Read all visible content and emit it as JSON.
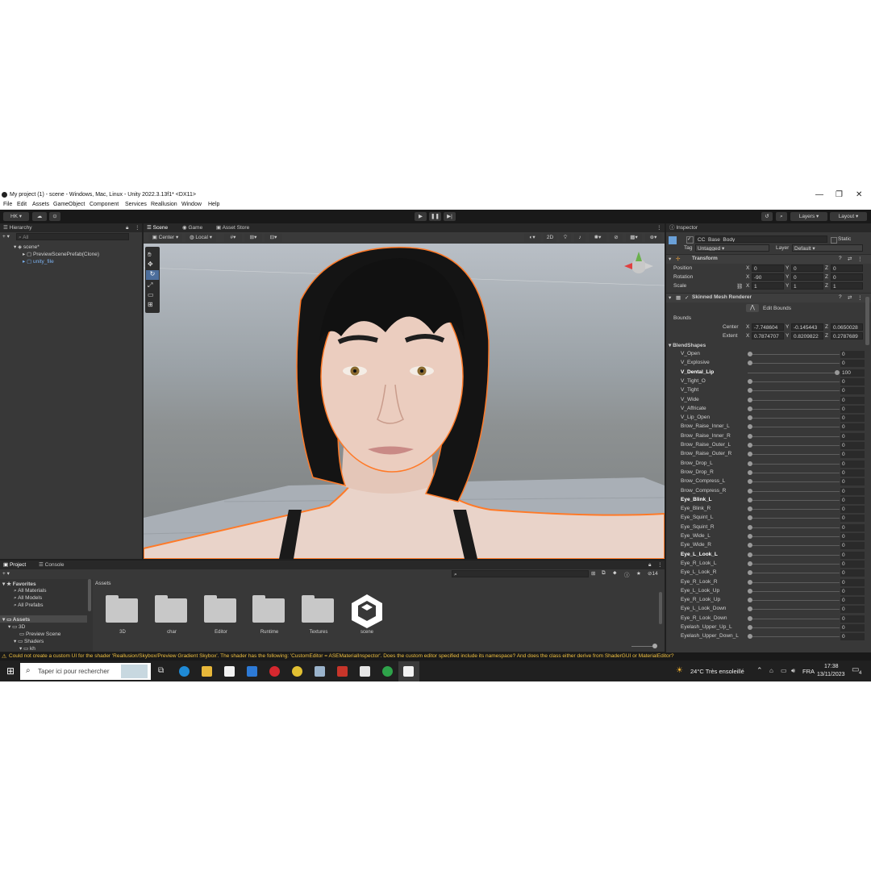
{
  "window": {
    "title": "My project (1) - scene - Windows, Mac, Linux - Unity 2022.3.13f1* <DX11>",
    "controls": [
      "—",
      "❐",
      "✕"
    ]
  },
  "menu": [
    "File",
    "Edit",
    "Assets",
    "GameObject",
    "Component",
    "Services",
    "Reallusion",
    "Window",
    "Help"
  ],
  "toolbar": {
    "account": "HK",
    "layers": "Layers",
    "layout": "Layout"
  },
  "hierarchy": {
    "tab": "Hierarchy",
    "search_placeholder": "All",
    "items": [
      {
        "label": "scene*"
      },
      {
        "label": "PreviewScenePrefab(Clone)"
      },
      {
        "label": "unity_file"
      }
    ]
  },
  "scene_tabs": [
    "Scene",
    "Game",
    "Asset Store"
  ],
  "scene_toolbar": {
    "pivot": "Center",
    "space": "Local",
    "mode_2d": "2D"
  },
  "inspector": {
    "tab": "Inspector",
    "object_name": "CC_Base_Body",
    "static_label": "Static",
    "tag_label": "Tag",
    "tag_value": "Untagged",
    "layer_label": "Layer",
    "layer_value": "Default",
    "transform": {
      "title": "Transform",
      "position_label": "Position",
      "rotation_label": "Rotation",
      "scale_label": "Scale",
      "position": [
        "0",
        "0",
        "0"
      ],
      "rotation": [
        "-90",
        "0",
        "0"
      ],
      "scale": [
        "1",
        "1",
        "1"
      ]
    },
    "smr": {
      "title": "Skinned Mesh Renderer",
      "edit_bounds": "Edit Bounds",
      "bounds_label": "Bounds",
      "center_label": "Center",
      "extent_label": "Extent",
      "center": [
        "-7.748604",
        "-0.145443",
        "0.0650028"
      ],
      "extent": [
        "0.7874707",
        "0.8209822",
        "0.2787689"
      ]
    },
    "blendshapes_label": "BlendShapes",
    "axis_x": "X",
    "axis_y": "Y",
    "axis_z": "Z",
    "blendshapes": [
      {
        "name": "V_Open",
        "value": "0",
        "bold": false
      },
      {
        "name": "V_Explosive",
        "value": "0",
        "bold": false
      },
      {
        "name": "V_Dental_Lip",
        "value": "100",
        "bold": true
      },
      {
        "name": "V_Tight_O",
        "value": "0",
        "bold": false
      },
      {
        "name": "V_Tight",
        "value": "0",
        "bold": false
      },
      {
        "name": "V_Wide",
        "value": "0",
        "bold": false
      },
      {
        "name": "V_Affricate",
        "value": "0",
        "bold": false
      },
      {
        "name": "V_Lip_Open",
        "value": "0",
        "bold": false
      },
      {
        "name": "Brow_Raise_Inner_L",
        "value": "0",
        "bold": false
      },
      {
        "name": "Brow_Raise_Inner_R",
        "value": "0",
        "bold": false
      },
      {
        "name": "Brow_Raise_Outer_L",
        "value": "0",
        "bold": false
      },
      {
        "name": "Brow_Raise_Outer_R",
        "value": "0",
        "bold": false
      },
      {
        "name": "Brow_Drop_L",
        "value": "0",
        "bold": false
      },
      {
        "name": "Brow_Drop_R",
        "value": "0",
        "bold": false
      },
      {
        "name": "Brow_Compress_L",
        "value": "0",
        "bold": false
      },
      {
        "name": "Brow_Compress_R",
        "value": "0",
        "bold": false
      },
      {
        "name": "Eye_Blink_L",
        "value": "0",
        "bold": true
      },
      {
        "name": "Eye_Blink_R",
        "value": "0",
        "bold": false
      },
      {
        "name": "Eye_Squint_L",
        "value": "0",
        "bold": false
      },
      {
        "name": "Eye_Squint_R",
        "value": "0",
        "bold": false
      },
      {
        "name": "Eye_Wide_L",
        "value": "0",
        "bold": false
      },
      {
        "name": "Eye_Wide_R",
        "value": "0",
        "bold": false
      },
      {
        "name": "Eye_L_Look_L",
        "value": "0",
        "bold": true
      },
      {
        "name": "Eye_R_Look_L",
        "value": "0",
        "bold": false
      },
      {
        "name": "Eye_L_Look_R",
        "value": "0",
        "bold": false
      },
      {
        "name": "Eye_R_Look_R",
        "value": "0",
        "bold": false
      },
      {
        "name": "Eye_L_Look_Up",
        "value": "0",
        "bold": false
      },
      {
        "name": "Eye_R_Look_Up",
        "value": "0",
        "bold": false
      },
      {
        "name": "Eye_L_Look_Down",
        "value": "0",
        "bold": false
      },
      {
        "name": "Eye_R_Look_Down",
        "value": "0",
        "bold": false
      },
      {
        "name": "Eyelash_Upper_Up_L",
        "value": "0",
        "bold": false
      },
      {
        "name": "Eyelash_Upper_Down_L",
        "value": "0",
        "bold": false
      }
    ]
  },
  "project": {
    "tabs": [
      "Project",
      "Console"
    ],
    "favorites_label": "Favorites",
    "favorites": [
      "All Materials",
      "All Models",
      "All Prefabs"
    ],
    "assets_label": "Assets",
    "tree": [
      "3D",
      "Preview Scene",
      "Shaders",
      "kh"
    ],
    "breadcrumb": "Assets",
    "hidden_count": "14",
    "items": [
      {
        "label": "3D"
      },
      {
        "label": "char"
      },
      {
        "label": "Editor"
      },
      {
        "label": "Runtime"
      },
      {
        "label": "Textures"
      },
      {
        "label": "scene"
      }
    ]
  },
  "status": {
    "message": "Could not create a custom UI for the shader 'Reallusion/Skybox/Preview Gradient Skybox'. The shader has the following: 'CustomEditor = ASEMaterialInspector'. Does the custom editor specified include its namespace? And does the class either derive from ShaderGUI or MaterialEditor?"
  },
  "taskbar": {
    "search_placeholder": "Taper ici pour rechercher",
    "weather": "24°C  Très ensoleillé",
    "language": "FRA",
    "time": "17:38",
    "date": "13/11/2023",
    "notifications": "4"
  }
}
